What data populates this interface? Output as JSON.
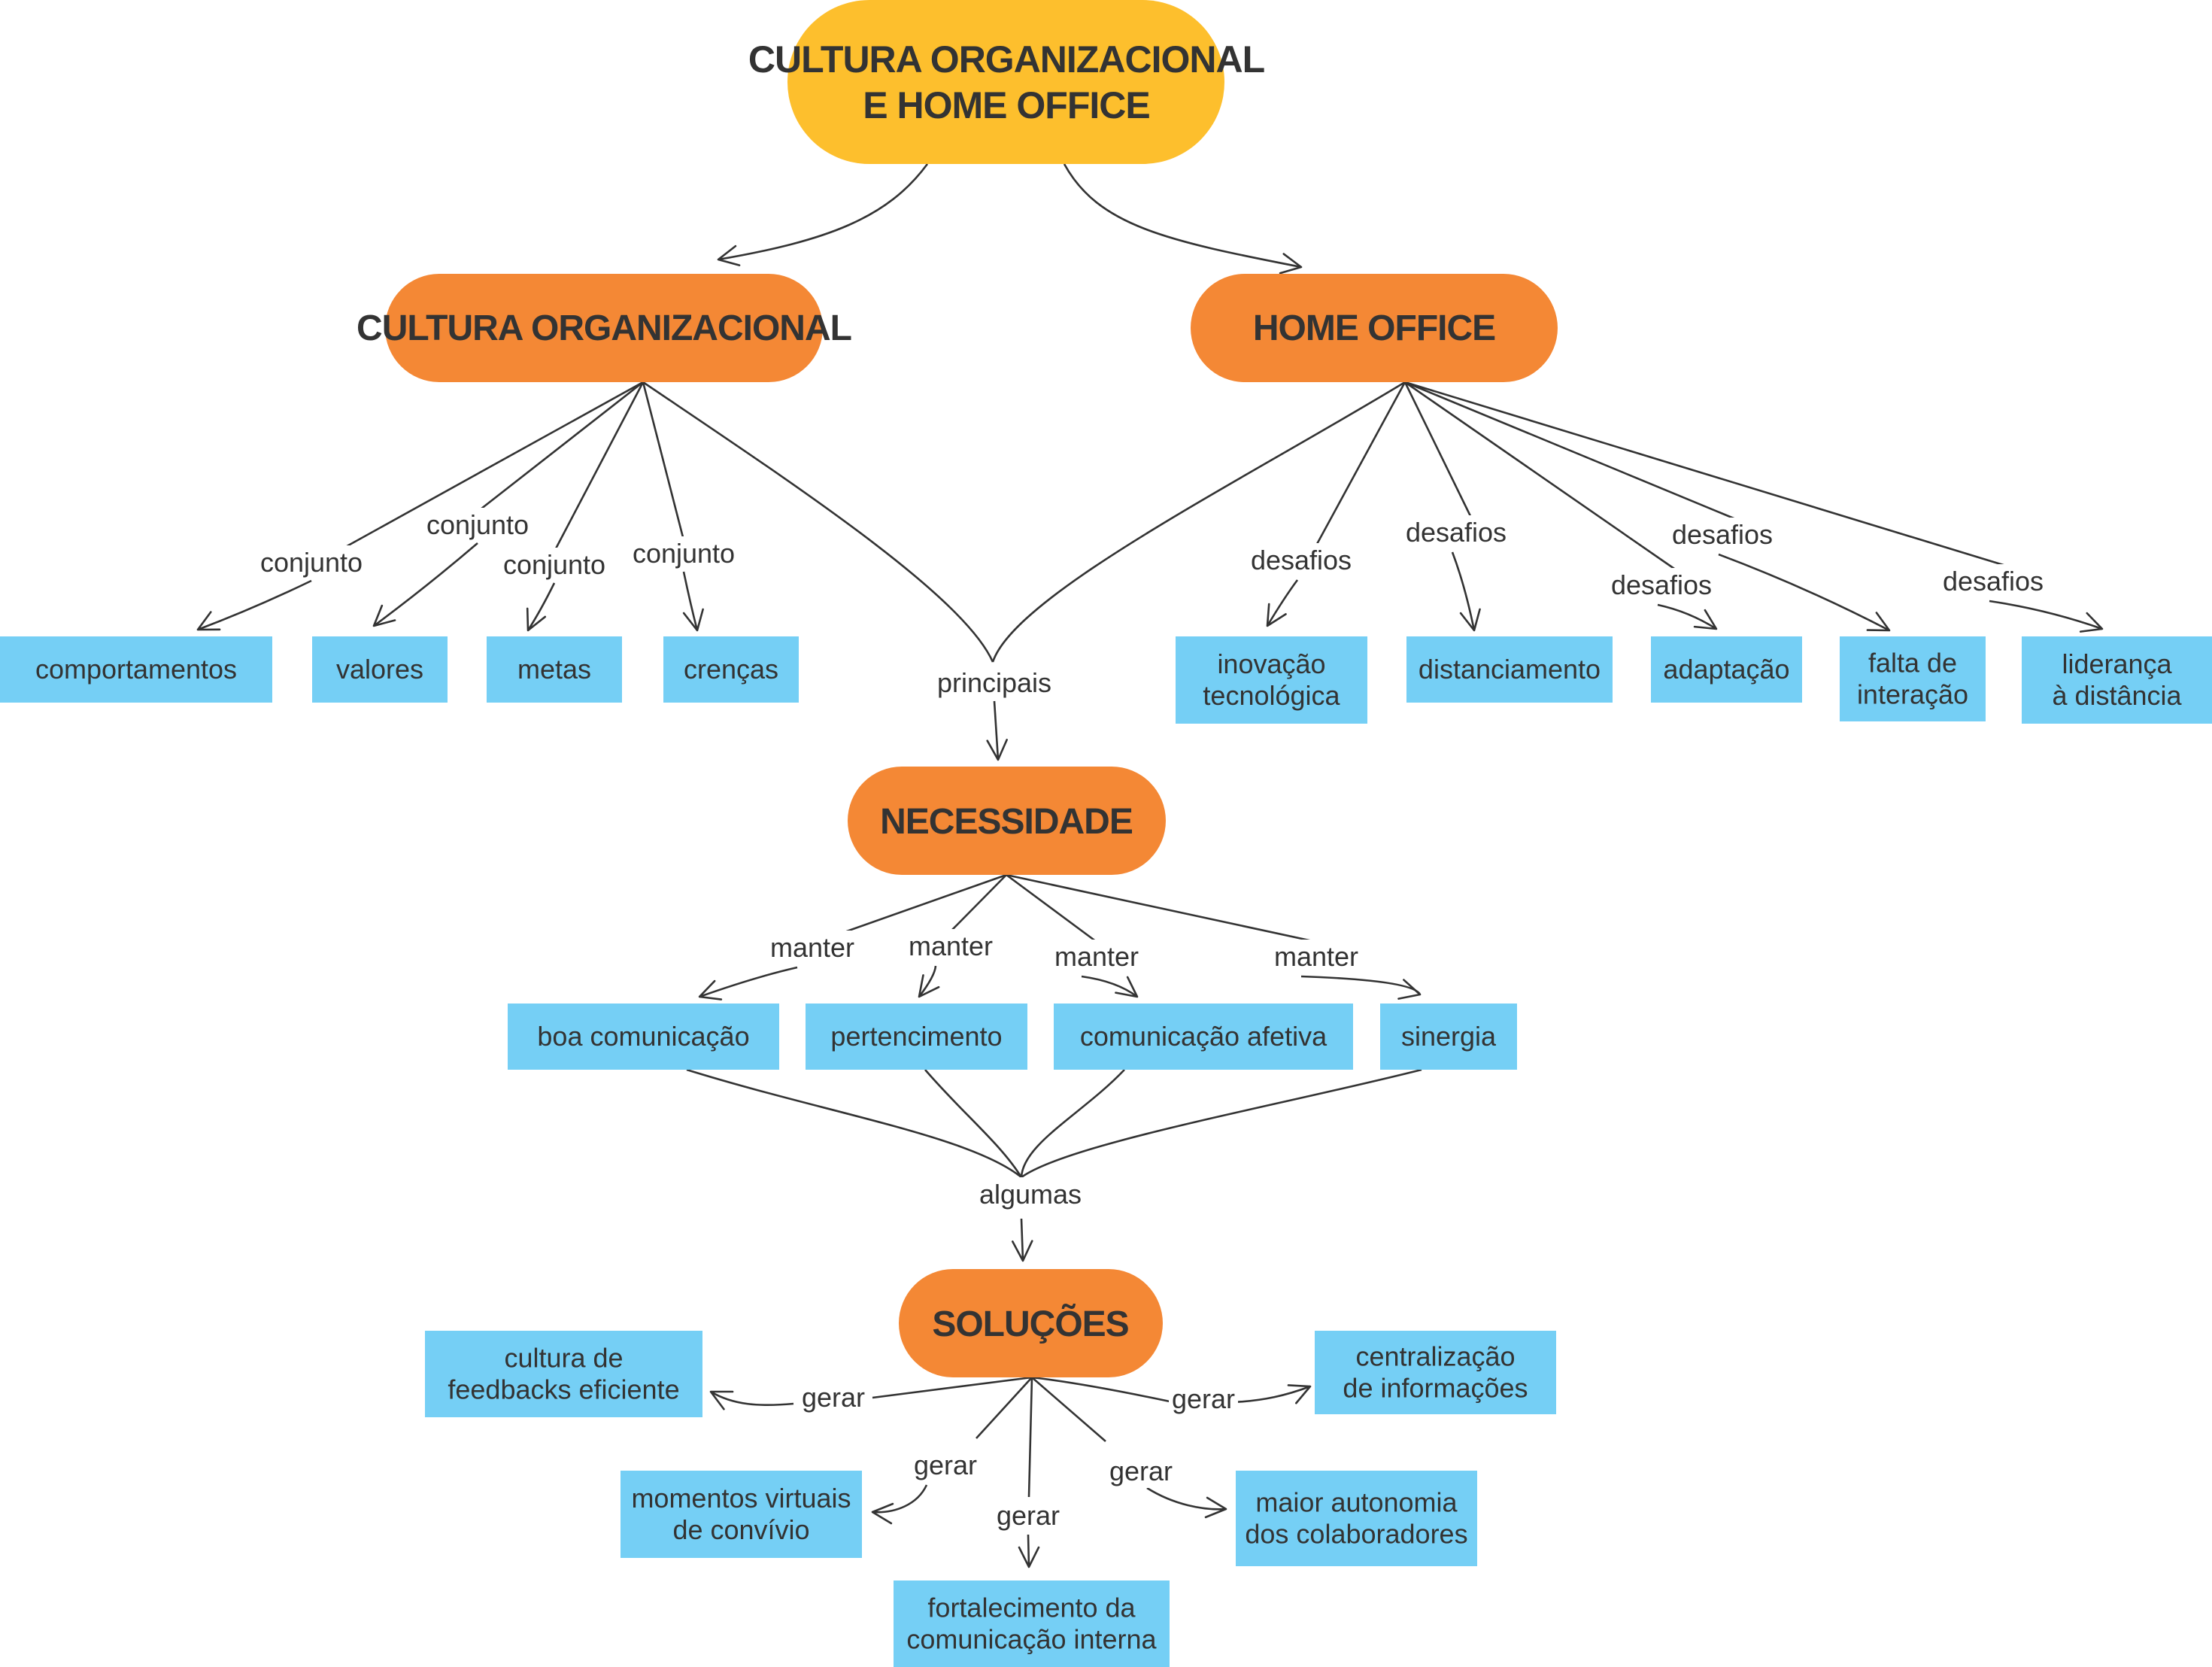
{
  "diagram": {
    "type": "concept-map",
    "root": {
      "lines": [
        "CULTURA ORGANIZACIONAL",
        "E HOME OFFICE"
      ],
      "color": "#FDBF2D"
    },
    "topic_color": "#F48835",
    "leaf_color": "#75CFF5",
    "text_color": "#333333",
    "topics": {
      "cultura": "CULTURA ORGANIZACIONAL",
      "home_office": "HOME OFFICE",
      "necessidade": "NECESSIDADE",
      "solucoes": "SOLUÇÕES"
    },
    "cultura_items": [
      {
        "label": [
          "comportamentos"
        ],
        "link": "conjunto"
      },
      {
        "label": [
          "valores"
        ],
        "link": "conjunto"
      },
      {
        "label": [
          "metas"
        ],
        "link": "conjunto"
      },
      {
        "label": [
          "crenças"
        ],
        "link": "conjunto"
      }
    ],
    "home_office_items": [
      {
        "label": [
          "inovação",
          "tecnológica"
        ],
        "link": "desafios"
      },
      {
        "label": [
          "distanciamento"
        ],
        "link": "desafios"
      },
      {
        "label": [
          "adaptação"
        ],
        "link": "desafios"
      },
      {
        "label": [
          "falta de",
          "interação"
        ],
        "link": "desafios"
      },
      {
        "label": [
          "liderança",
          "à distância"
        ],
        "link": "desafios"
      }
    ],
    "principais_link": "principais",
    "necessidade_items": [
      {
        "label": [
          "boa comunicação"
        ],
        "link": "manter"
      },
      {
        "label": [
          "pertencimento"
        ],
        "link": "manter"
      },
      {
        "label": [
          "comunicação afetiva"
        ],
        "link": "manter"
      },
      {
        "label": [
          "sinergia"
        ],
        "link": "manter"
      }
    ],
    "algumas_link": "algumas",
    "solucoes_items": [
      {
        "label": [
          "cultura de",
          "feedbacks eficiente"
        ],
        "link": "gerar"
      },
      {
        "label": [
          "centralização",
          "de informações"
        ],
        "link": "gerar"
      },
      {
        "label": [
          "momentos virtuais",
          "de convívio"
        ],
        "link": "gerar"
      },
      {
        "label": [
          "maior autonomia",
          "dos colaboradores"
        ],
        "link": "gerar"
      },
      {
        "label": [
          "fortalecimento da",
          "comunicação interna"
        ],
        "link": "gerar"
      }
    ]
  }
}
